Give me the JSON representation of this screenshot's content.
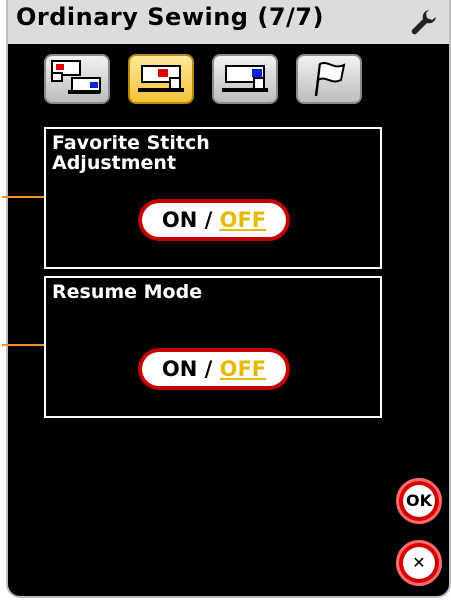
{
  "header": {
    "title": "Ordinary Sewing (7/7)",
    "settings_icon": "wrench-icon"
  },
  "tabs": [
    {
      "icon": "two-machines-icon",
      "active": false
    },
    {
      "icon": "sewing-machine-red-icon",
      "active": true
    },
    {
      "icon": "sewing-machine-blue-icon",
      "active": false
    },
    {
      "icon": "flag-icon",
      "active": false
    }
  ],
  "settings": [
    {
      "title_line1": "Favorite Stitch",
      "title_line2": "Adjustment",
      "on_label": "ON",
      "separator": "/",
      "off_label": "OFF",
      "value": "OFF"
    },
    {
      "title_line1": "Resume Mode",
      "title_line2": "",
      "on_label": "ON",
      "separator": "/",
      "off_label": "OFF",
      "value": "OFF"
    }
  ],
  "buttons": {
    "ok_label": "OK",
    "close_label": "✕"
  },
  "colors": {
    "accent_red": "#d40000",
    "off_yellow": "#e6b800",
    "active_tab": "#f4c23a",
    "leader_orange": "#ff8c2a"
  }
}
